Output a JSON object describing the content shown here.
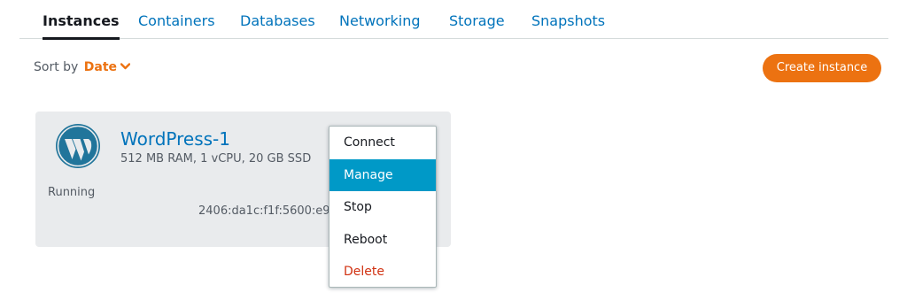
{
  "tabs": [
    "Instances",
    "Containers",
    "Databases",
    "Networking",
    "Storage",
    "Snapshots"
  ],
  "active_tab": "Instances",
  "sort": {
    "label": "Sort by",
    "value": "Date"
  },
  "create_button": "Create instance",
  "instance": {
    "name": "WordPress-1",
    "specs": "512 MB RAM, 1 vCPU, 20 GB SSD",
    "status": "Running",
    "ip": "2406:da1c:f1f:5600:e9",
    "logo": "wordpress-logo"
  },
  "menu": {
    "items": [
      "Connect",
      "Manage",
      "Stop",
      "Reboot",
      "Delete"
    ],
    "highlighted": "Manage",
    "danger": "Delete"
  },
  "colors": {
    "accent_orange": "#ec7211",
    "link_blue": "#0073bb",
    "highlight_blue": "#0099c7",
    "danger_red": "#d13212",
    "card_bg": "#e9ebed"
  }
}
